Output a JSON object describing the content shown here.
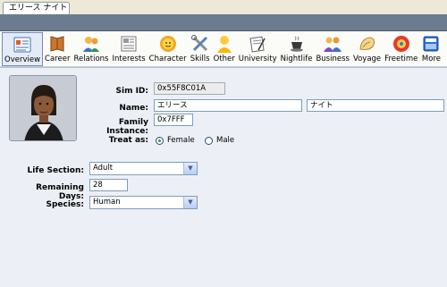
{
  "window": {
    "tab_title": "エリース ナイト"
  },
  "toolbar": {
    "items": [
      {
        "label": "Overview",
        "icon": "overview-icon"
      },
      {
        "label": "Career",
        "icon": "career-icon"
      },
      {
        "label": "Relations",
        "icon": "relations-icon"
      },
      {
        "label": "Interests",
        "icon": "interests-icon"
      },
      {
        "label": "Character",
        "icon": "character-icon"
      },
      {
        "label": "Skills",
        "icon": "skills-icon"
      },
      {
        "label": "Other",
        "icon": "other-icon"
      },
      {
        "label": "University",
        "icon": "university-icon"
      },
      {
        "label": "Nightlife",
        "icon": "nightlife-icon"
      },
      {
        "label": "Business",
        "icon": "business-icon"
      },
      {
        "label": "Voyage",
        "icon": "voyage-icon"
      },
      {
        "label": "Freetime",
        "icon": "freetime-icon"
      },
      {
        "label": "More",
        "icon": "more-icon"
      }
    ],
    "active": "Overview"
  },
  "form": {
    "sim_id_label": "Sim ID:",
    "sim_id": "0x55F8C01A",
    "name_label": "Name:",
    "first_name": "エリース",
    "last_name": "ナイト",
    "family_label": "Family Instance:",
    "family_instance": "0x7FFF",
    "treat_label": "Treat as:",
    "female_label": "Female",
    "male_label": "Male",
    "treat_selected": "Female",
    "life_label": "Life Section:",
    "life_section": "Adult",
    "days_label": "Remaining Days:",
    "remaining_days": "28",
    "species_label": "Species:",
    "species": "Human"
  }
}
